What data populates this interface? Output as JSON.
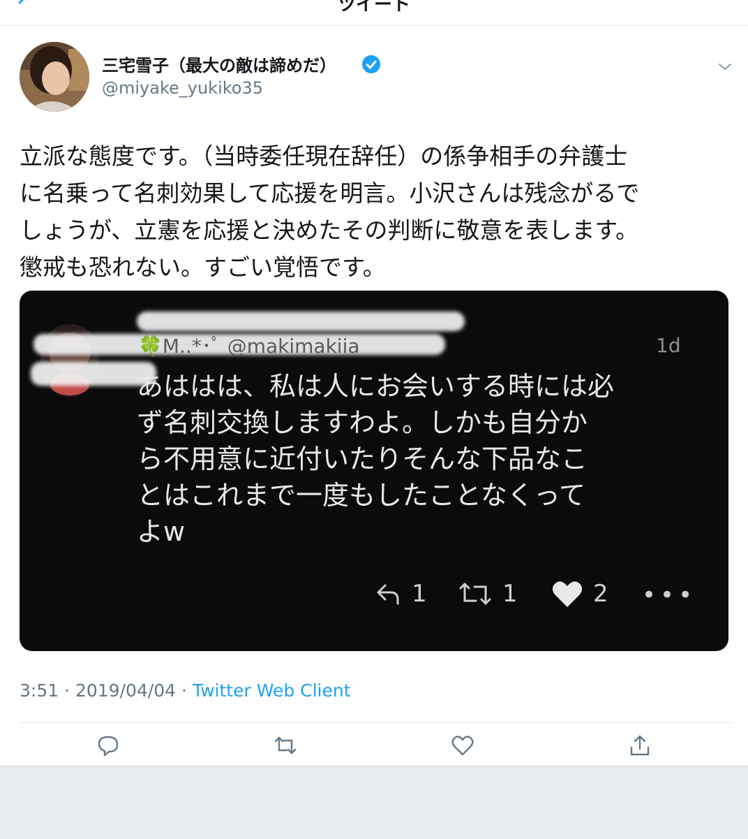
{
  "header": {
    "title": "ツイート"
  },
  "tweet": {
    "display_name": "三宅雪子（最大の敵は諦めだ）",
    "handle": "@miyake_yukiko35",
    "text": "立派な態度です。（当時委任現在辞任）の係争相手の弁護士\nに名乗って名刺効果して応援を明言。小沢さんは残念がるで\nしょうが、立憲を応援と決めたその判断に敬意を表します。\n懲戒も恐れない。すごい覚悟です。",
    "time": "3:51",
    "date": "2019/04/04",
    "client": "Twitter Web Client",
    "separator": "·"
  },
  "embedded": {
    "name": "🍀M..*･ﾟ @makimakiia",
    "time": "1d",
    "text": "あははは、私は人にお会いする時には必\nず名刺交換しますわよ。しかも自分か\nら不用意に近付いたりそんな下品なこ\nとはこれまで一度もしたことなくって\nよw",
    "reply_count": "1",
    "retweet_count": "1",
    "like_count": "2",
    "more": "•••"
  },
  "colors": {
    "accent": "#1da1f2",
    "verified": "#1da1f2",
    "embed_bg": "#0b0b0b"
  },
  "icons": [
    "back-chevron-icon",
    "verified-badge-icon",
    "chevron-down-icon",
    "reply-icon",
    "retweet-icon",
    "like-icon",
    "share-icon",
    "more-icon"
  ]
}
